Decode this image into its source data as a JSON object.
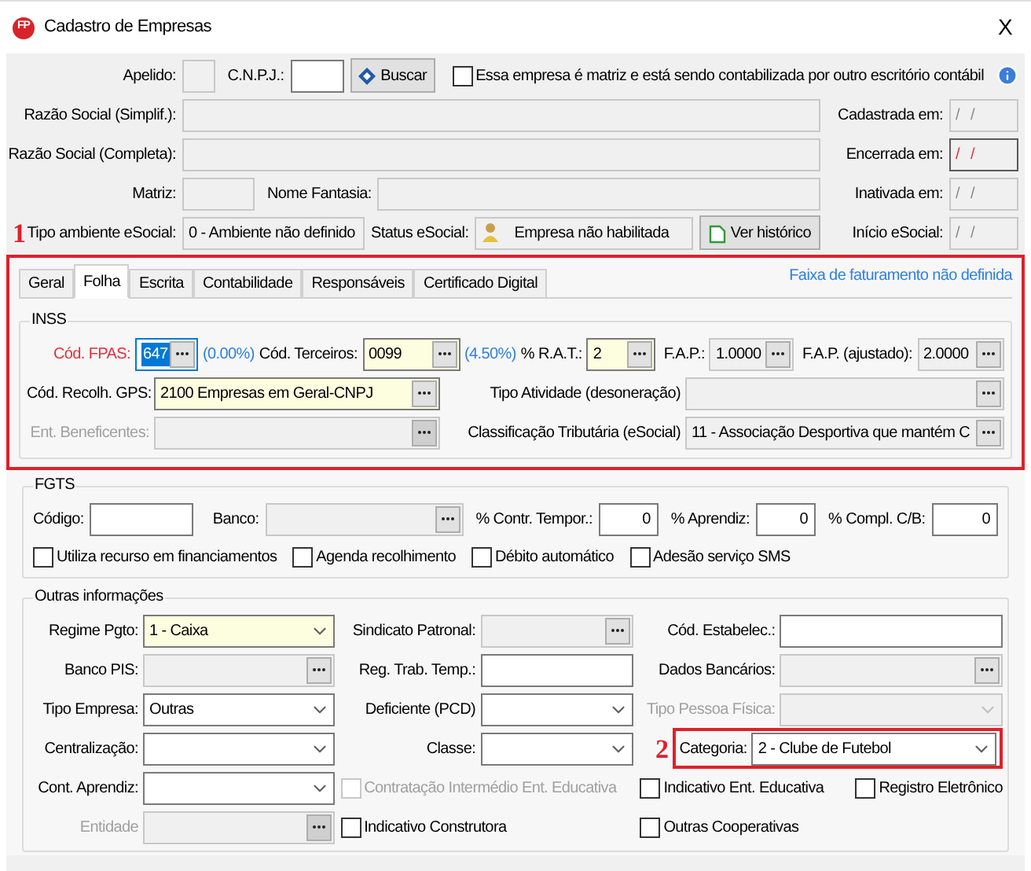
{
  "window": {
    "logo": "FP",
    "title": "Cadastro de Empresas",
    "close": "X"
  },
  "header": {
    "apelido": {
      "label": "Apelido:",
      "readonly": true
    },
    "cnpj": {
      "label": "C.N.P.J.:",
      "readonly": false
    },
    "search_button": "Buscar",
    "matriz_option": {
      "label": "Essa empresa é matriz e está sendo contabilizada por outro escritório contábil",
      "checked": false
    },
    "razao_simplificada": {
      "label": "Razão Social (Simplif.):",
      "readonly": true
    },
    "razao_completa": {
      "label": "Razão Social (Completa):",
      "readonly": true
    },
    "matriz": {
      "label": "Matriz:",
      "readonly": true
    },
    "nome_fantasia": {
      "label": "Nome Fantasia:",
      "readonly": true
    },
    "annotation": "1",
    "tipo_ambiente": {
      "label": "Tipo ambiente eSocial:",
      "readonly": true,
      "value": "0 - Ambiente não definido"
    },
    "status_esocial": {
      "label": "Status eSocial:",
      "kind": "status",
      "readonly": true,
      "value": "Empresa não habilitada"
    },
    "history_button": "Ver histórico",
    "dates": [
      {
        "label": "Cadastrada em:",
        "kind": "date",
        "invalid": false,
        "value": "/ /"
      },
      {
        "label": "Encerrada em:",
        "kind": "date",
        "invalid": true,
        "value": "/ /"
      },
      {
        "label": "Inativada em:",
        "kind": "date",
        "invalid": false,
        "value": "/ /"
      },
      {
        "label": "Início eSocial:",
        "kind": "date",
        "invalid": false,
        "value": "/ /"
      }
    ]
  },
  "tabs": [
    {
      "label": "Geral",
      "selected": false
    },
    {
      "label": "Folha",
      "selected": true
    },
    {
      "label": "Escrita",
      "selected": false
    },
    {
      "label": "Contabilidade",
      "selected": false
    },
    {
      "label": "Responsáveis",
      "selected": false
    },
    {
      "label": "Certificado Digital",
      "selected": false
    }
  ],
  "revenue_link": "Faixa de faturamento não definida",
  "inss": {
    "title": "INSS",
    "fpas": {
      "label": "Cód. FPAS:",
      "kind": "lookup",
      "focused": true,
      "value": "647"
    },
    "fpas_rate": "(0.00%)",
    "terceiros": {
      "label": "Cód. Terceiros:",
      "kind": "lookup",
      "required": true,
      "value": "0099"
    },
    "terceiros_rate": "(4.50%)",
    "rat": {
      "label": "% R.A.T.:",
      "kind": "lookup",
      "required": true,
      "value": "2"
    },
    "fap": {
      "label": "F.A.P.:",
      "kind": "lookup",
      "readonly": true,
      "value": "1.0000"
    },
    "fap_ajustado": {
      "label": "F.A.P. (ajustado):",
      "kind": "lookup",
      "readonly": true,
      "value": "2.0000"
    },
    "gps": {
      "label": "Cód. Recolh. GPS:",
      "kind": "lookup",
      "required": true,
      "value": "2100 Empresas em Geral-CNPJ"
    },
    "tipo_atividade": {
      "label": "Tipo Atividade (desoneração)",
      "kind": "lookup",
      "readonly": true
    },
    "beneficentes": {
      "label": "Ent. Beneficentes:",
      "kind": "lookup",
      "readonly": true,
      "disabled": true
    },
    "classificacao": {
      "label": "Classificação Tributária (eSocial)",
      "kind": "lookup",
      "readonly": true,
      "value": "11 - Associação Desportiva que mantém C"
    }
  },
  "fgts": {
    "title": "FGTS",
    "codigo": {
      "label": "Código:",
      "readonly": false
    },
    "banco": {
      "label": "Banco:",
      "kind": "lookup",
      "readonly": true
    },
    "contr_tempor": {
      "label": "% Contr. Tempor.:",
      "kind": "number",
      "readonly": false,
      "value": "0"
    },
    "aprendiz": {
      "label": "% Aprendiz:",
      "kind": "number",
      "readonly": false,
      "value": "0"
    },
    "compl": {
      "label": "% Compl. C/B:",
      "kind": "number",
      "readonly": false,
      "value": "0"
    },
    "options": [
      {
        "label": "Utiliza recurso em financiamentos",
        "checked": false
      },
      {
        "label": "Agenda recolhimento",
        "checked": false
      },
      {
        "label": "Débito automático",
        "checked": false
      },
      {
        "label": "Adesão serviço SMS",
        "checked": false
      }
    ]
  },
  "outras": {
    "title": "Outras informações",
    "columns": [
      [
        {
          "kind": "combo",
          "label": "Regime Pgto:",
          "required": true,
          "readonly": false,
          "disabled": false,
          "value": "1 - Caixa"
        },
        {
          "kind": "lookup",
          "label": "Banco PIS:",
          "required": false,
          "readonly": true,
          "disabled": false
        },
        {
          "kind": "combo",
          "label": "Tipo Empresa:",
          "required": false,
          "readonly": false,
          "disabled": false,
          "value": "Outras"
        },
        {
          "kind": "combo",
          "label": "Centralização:",
          "required": false,
          "readonly": false,
          "disabled": false
        },
        {
          "kind": "combo",
          "label": "Cont. Aprendiz:",
          "required": false,
          "readonly": false,
          "disabled": false
        },
        {
          "kind": "lookup",
          "label": "Entidade",
          "required": false,
          "readonly": true,
          "disabled": true
        }
      ],
      [
        {
          "kind": "lookup",
          "label": "Sindicato Patronal:",
          "required": false,
          "readonly": true,
          "disabled": false
        },
        {
          "kind": "text",
          "label": "Reg. Trab. Temp.:",
          "required": false,
          "readonly": false,
          "disabled": false
        },
        {
          "kind": "combo",
          "label": "Deficiente (PCD)",
          "required": false,
          "readonly": false,
          "disabled": false
        },
        {
          "kind": "combo",
          "label": "Classe:",
          "required": false,
          "readonly": false,
          "disabled": false
        },
        {
          "kind": "checks",
          "options": [
            {
              "label": "Contratação Intermédio Ent. Educativa",
              "checked": false,
              "disabled": true
            }
          ]
        },
        {
          "kind": "checks",
          "options": [
            {
              "label": "Indicativo Construtora",
              "checked": false,
              "disabled": false
            }
          ]
        }
      ],
      [
        {
          "kind": "text",
          "label": "Cód. Estabelec.:",
          "required": false,
          "readonly": false,
          "disabled": false
        },
        {
          "kind": "lookup",
          "label": "Dados Bancários:",
          "required": false,
          "readonly": true,
          "disabled": false
        },
        {
          "kind": "combo",
          "label": "Tipo Pessoa Física:",
          "required": false,
          "readonly": true,
          "disabled": true
        },
        {
          "kind": "combo",
          "label": "Categoria:",
          "required": false,
          "readonly": false,
          "disabled": false,
          "value": "2 -  Clube de Futebol",
          "annotation": "2"
        },
        {
          "kind": "checks",
          "options": [
            {
              "label": "Indicativo Ent. Educativa",
              "checked": false,
              "disabled": false
            },
            {
              "label": "Registro Eletrônico",
              "checked": false,
              "disabled": false
            }
          ]
        },
        {
          "kind": "checks",
          "options": [
            {
              "label": "Outras Cooperativas",
              "checked": false,
              "disabled": false
            }
          ]
        }
      ]
    ]
  }
}
